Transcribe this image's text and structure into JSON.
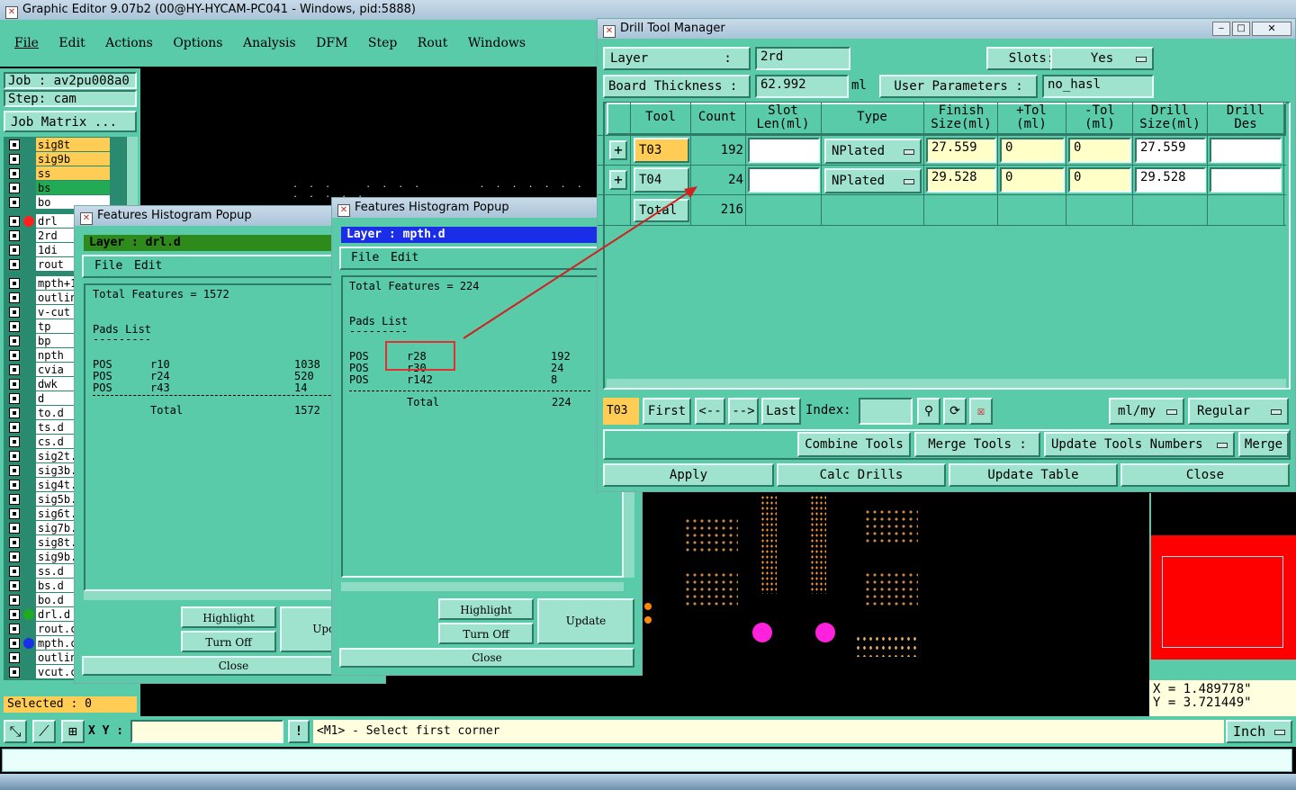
{
  "app": {
    "title": "Graphic Editor 9.07b2 (00@HY-HYCAM-PC041 - Windows, pid:5888)",
    "menu": [
      "File",
      "Edit",
      "Actions",
      "Options",
      "Analysis",
      "DFM",
      "Step",
      "Rout",
      "Windows"
    ],
    "job_label": "Job : av2pu008a0",
    "step_label": "Step: cam",
    "job_matrix_button": "Job Matrix ...",
    "selected_label": "Selected : 0"
  },
  "layers": [
    {
      "name": "sig8t",
      "bg": "#ffcc55"
    },
    {
      "name": "sig9b",
      "bg": "#ffcc55"
    },
    {
      "name": "ss",
      "bg": "#ffcc55"
    },
    {
      "name": "bs",
      "bg": "#22aa55"
    },
    {
      "name": "bo",
      "bg": "#ffffff"
    },
    {
      "name": "drl",
      "bg": "#ffffff"
    },
    {
      "name": "2rd",
      "bg": "#ffffff"
    },
    {
      "name": "1di",
      "bg": "#ffffff"
    },
    {
      "name": "rout",
      "bg": "#ffffff"
    },
    {
      "name": "mpth+1",
      "bg": "#ffffff"
    },
    {
      "name": "outlin",
      "bg": "#ffffff"
    },
    {
      "name": "v-cut",
      "bg": "#ffffff"
    },
    {
      "name": "tp",
      "bg": "#ffffff"
    },
    {
      "name": "bp",
      "bg": "#ffffff"
    },
    {
      "name": "npth",
      "bg": "#ffffff"
    },
    {
      "name": "cvia",
      "bg": "#ffffff"
    },
    {
      "name": "dwk",
      "bg": "#ffffff"
    },
    {
      "name": "d",
      "bg": "#ffffff"
    },
    {
      "name": "to.d",
      "bg": "#ffffff"
    },
    {
      "name": "ts.d",
      "bg": "#ffffff"
    },
    {
      "name": "cs.d",
      "bg": "#ffffff"
    },
    {
      "name": "sig2t.",
      "bg": "#ffffff"
    },
    {
      "name": "sig3b.",
      "bg": "#ffffff"
    },
    {
      "name": "sig4t.",
      "bg": "#ffffff"
    },
    {
      "name": "sig5b.",
      "bg": "#ffffff"
    },
    {
      "name": "sig6t.",
      "bg": "#ffffff"
    },
    {
      "name": "sig7b.",
      "bg": "#ffffff"
    },
    {
      "name": "sig8t.",
      "bg": "#ffffff"
    },
    {
      "name": "sig9b.",
      "bg": "#ffffff"
    },
    {
      "name": "ss.d",
      "bg": "#ffffff"
    },
    {
      "name": "bs.d",
      "bg": "#ffffff"
    },
    {
      "name": "bo.d",
      "bg": "#ffffff"
    },
    {
      "name": "drl.d",
      "bg": "#ffffff"
    },
    {
      "name": "rout.c",
      "bg": "#ffffff"
    },
    {
      "name": "mpth.c",
      "bg": "#ffffff"
    },
    {
      "name": "outlin",
      "bg": "#ffffff"
    },
    {
      "name": "vcut.c",
      "bg": "#ffffff"
    }
  ],
  "hist1": {
    "title": "Features Histogram Popup",
    "layer": "Layer :  drl.d",
    "menu_file": "File",
    "menu_edit": "Edit",
    "total_features": "Total Features = 1572",
    "pads_list": "Pads List",
    "underline": "---------",
    "rows": [
      {
        "pos": "POS",
        "sym": "r10",
        "count": "1038"
      },
      {
        "pos": "POS",
        "sym": "r24",
        "count": "520"
      },
      {
        "pos": "POS",
        "sym": "r43",
        "count": "14"
      }
    ],
    "total_label": "Total",
    "total_value": "1572",
    "highlight": "Highlight",
    "turn_off": "Turn Off",
    "update": "Update",
    "close": "Close"
  },
  "hist2": {
    "title": "Features Histogram Popup",
    "layer": "Layer :  mpth.d",
    "menu_file": "File",
    "menu_edit": "Edit",
    "total_features": "Total Features = 224",
    "pads_list": "Pads List",
    "underline": "---------",
    "rows": [
      {
        "pos": "POS",
        "sym": "r28",
        "count": "192"
      },
      {
        "pos": "POS",
        "sym": "r30",
        "count": "24"
      },
      {
        "pos": "POS",
        "sym": "r142",
        "count": "8"
      }
    ],
    "total_label": "Total",
    "total_value": "224",
    "highlight": "Highlight",
    "turn_off": "Turn Off",
    "update": "Update",
    "close": "Close"
  },
  "dtm": {
    "title": "Drill Tool Manager",
    "layer_label": "Layer          :",
    "layer_value": "2rd",
    "slots_label": "Slots:",
    "slots_value": "Yes",
    "board_thickness_label": "Board Thickness :",
    "board_thickness_value": "62.992",
    "thickness_unit": "ml",
    "user_params_label": "User Parameters :",
    "user_params_value": "no_hasl",
    "headers": {
      "tool": "Tool",
      "count": "Count",
      "slot_len_1": "Slot",
      "slot_len_2": "Len(ml)",
      "type": "Type",
      "finish_1": "Finish",
      "finish_2": "Size(ml)",
      "ptol_1": "+Tol",
      "ptol_2": "(ml)",
      "mtol_1": "-Tol",
      "mtol_2": "(ml)",
      "drill_1": "Drill",
      "drill_2": "Size(ml)",
      "des_1": "Drill",
      "des_2": "Des"
    },
    "rows": [
      {
        "tool": "T03",
        "count": "192",
        "slot_len": "",
        "type": "NPlated",
        "finish": "27.559",
        "ptol": "0",
        "mtol": "0",
        "drill": "27.559",
        "des": ""
      },
      {
        "tool": "T04",
        "count": "24",
        "slot_len": "",
        "type": "NPlated",
        "finish": "29.528",
        "ptol": "0",
        "mtol": "0",
        "drill": "29.528",
        "des": ""
      }
    ],
    "total_label": "Total",
    "total_value": "216",
    "current_tool": "T03",
    "first": "First",
    "prev": "<--",
    "next": "-->",
    "last": "Last",
    "index_label": "Index:",
    "units": "ml/my",
    "mode": "Regular",
    "combine_tools": "Combine Tools",
    "merge_tools_label": "Merge Tools :",
    "update_tools_numbers": "Update Tools Numbers",
    "merge": "Merge",
    "apply": "Apply",
    "calc_drills": "Calc Drills",
    "update_table": "Update Table",
    "close": "Close"
  },
  "status": {
    "xy_label": "X Y :",
    "message": "<M1> - Select first corner",
    "unit": "Inch",
    "coord_x": "X  = 1.489778\"",
    "coord_y": "Y  = 3.721449\""
  }
}
